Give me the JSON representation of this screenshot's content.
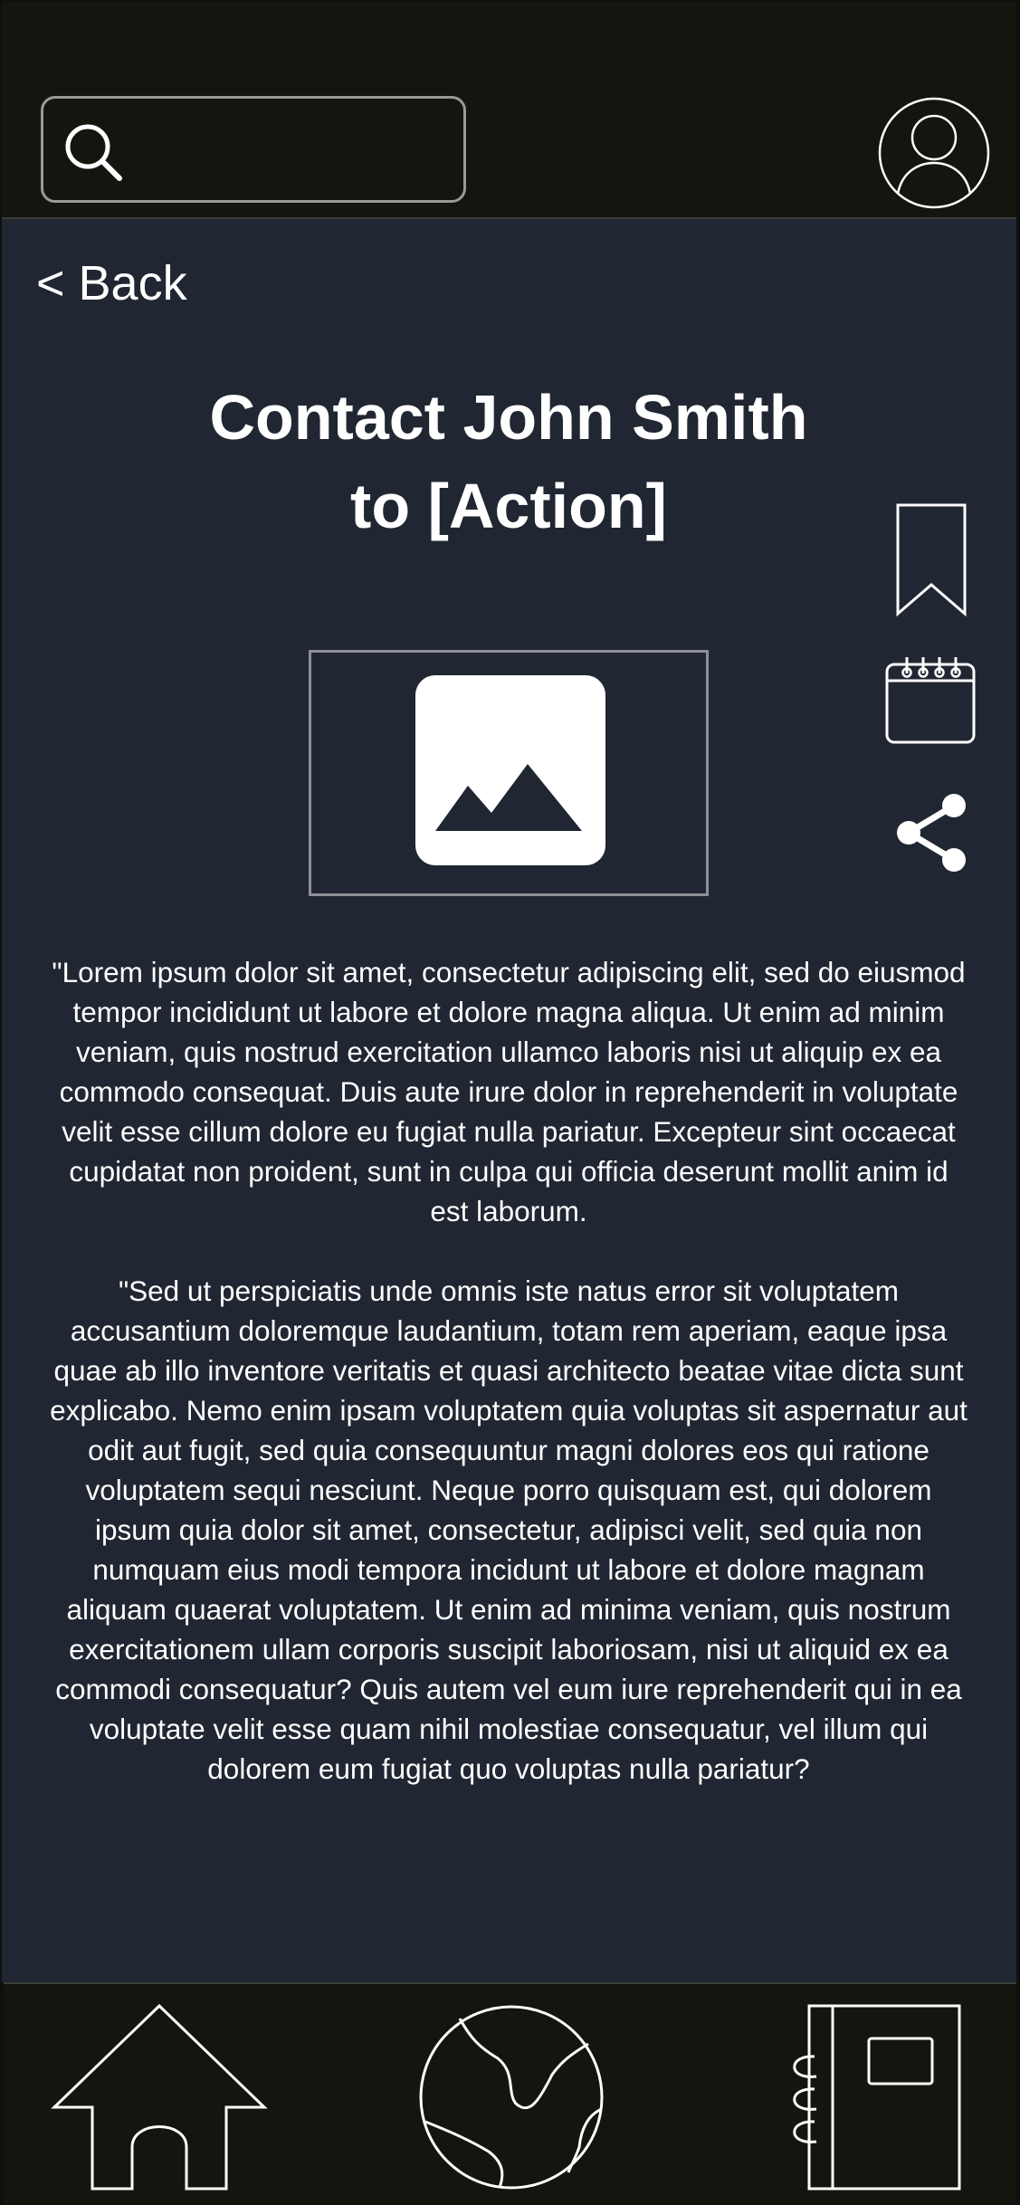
{
  "header": {
    "search": {
      "placeholder": "",
      "value": ""
    },
    "avatar_icon": "user-circle-icon"
  },
  "main": {
    "back_label": "< Back",
    "title_line1": "Contact John Smith",
    "title_line2": "to [Action]",
    "image_icon": "image-placeholder-icon",
    "paragraphs": [
      "\"Lorem ipsum dolor sit amet, consectetur adipiscing elit, sed do eiusmod tempor incididunt ut labore et dolore magna aliqua. Ut enim ad minim veniam, quis nostrud exercitation ullamco laboris nisi ut aliquip ex ea commodo consequat. Duis aute irure dolor in reprehenderit in voluptate velit esse cillum dolore eu fugiat nulla pariatur. Excepteur sint occaecat cupidatat non proident, sunt in culpa qui officia deserunt mollit anim id est laborum.",
      "\"Sed ut perspiciatis unde omnis iste natus error sit voluptatem accusantium doloremque laudantium, totam rem aperiam, eaque ipsa quae ab illo inventore veritatis et quasi architecto beatae vitae dicta sunt explicabo. Nemo enim ipsam voluptatem quia voluptas sit aspernatur aut odit aut fugit, sed quia consequuntur magni dolores eos qui ratione voluptatem sequi nesciunt. Neque porro quisquam est, qui dolorem ipsum quia dolor sit amet, consectetur, adipisci velit, sed quia non numquam eius modi tempora incidunt ut labore et dolore magnam aliquam quaerat voluptatem. Ut enim ad minima veniam, quis nostrum exercitationem ullam corporis suscipit laboriosam, nisi ut aliquid ex ea commodi consequatur? Quis autem vel eum iure reprehenderit qui in ea voluptate velit esse quam nihil molestiae consequatur, vel illum qui dolorem eum fugiat quo voluptas nulla pariatur?"
    ]
  },
  "action_rail": {
    "items": [
      "bookmark-icon",
      "calendar-icon",
      "share-icon"
    ]
  },
  "bottom_nav": {
    "items": [
      "home-icon",
      "globe-icon",
      "notebook-icon"
    ]
  },
  "colors": {
    "header_bg": "#13160f",
    "content_bg": "#202732",
    "icon_stroke": "#ffffff",
    "border": "#9a9a96"
  }
}
